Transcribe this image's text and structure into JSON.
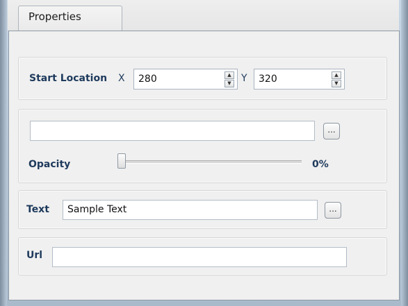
{
  "window": {
    "tab_title": "Properties"
  },
  "start_location": {
    "label": "Start Location",
    "x_label": "X",
    "x_value": "280",
    "y_label": "Y",
    "y_value": "320"
  },
  "image_panel": {
    "path_value": "",
    "browse_label": "...",
    "opacity_label": "Opacity",
    "opacity_value": "0%",
    "opacity_fraction": 0
  },
  "text_panel": {
    "label": "Text",
    "value": "Sample Text",
    "browse_label": "..."
  },
  "url_panel": {
    "label": "Url",
    "value": ""
  }
}
